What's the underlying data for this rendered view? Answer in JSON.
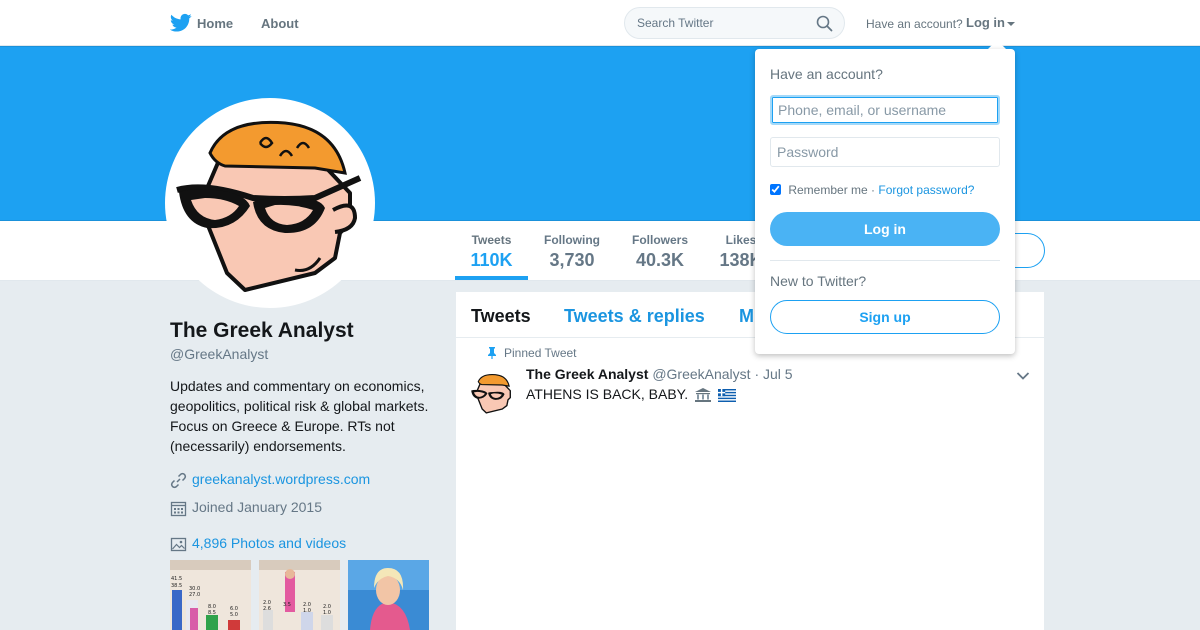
{
  "nav": {
    "home_label": "Home",
    "about_label": "About",
    "search_placeholder": "Search Twitter",
    "have_account_text": "Have an account?",
    "login_label": "Log in"
  },
  "profile": {
    "name": "The Greek Analyst",
    "handle": "@GreekAnalyst",
    "bio": "Updates and commentary on economics, geopolitics, political risk & global markets. Focus on Greece & Europe. RTs not (necessarily) endorsements.",
    "website": "greekanalyst.wordpress.com",
    "joined": "Joined January 2015",
    "photos_label": "4,896 Photos and videos"
  },
  "stats": [
    {
      "label": "Tweets",
      "value": "110K",
      "active": true
    },
    {
      "label": "Following",
      "value": "3,730",
      "active": false
    },
    {
      "label": "Followers",
      "value": "40.3K",
      "active": false
    },
    {
      "label": "Likes",
      "value": "138K",
      "active": false
    }
  ],
  "timeline": {
    "tabs": [
      {
        "label": "Tweets",
        "active": true
      },
      {
        "label": "Tweets & replies",
        "active": false
      },
      {
        "label": "M",
        "active": false
      }
    ],
    "pinned_label": "Pinned Tweet",
    "tweet": {
      "name": "The Greek Analyst",
      "handle": "@GreekAnalyst",
      "date": "· Jul 5",
      "text": "ATHENS IS BACK, BABY."
    }
  },
  "login_dropdown": {
    "title": "Have an account?",
    "username_placeholder": "Phone, email, or username",
    "password_placeholder": "Password",
    "remember_label": "Remember me ·",
    "forgot_label": "Forgot password?",
    "login_button": "Log in",
    "new_text": "New to Twitter?",
    "signup_button": "Sign up"
  },
  "colors": {
    "brand": "#1da1f2",
    "background": "#e6ecf0"
  },
  "icons": [
    "twitter-bird-icon",
    "search-icon",
    "link-icon",
    "calendar-icon",
    "photo-icon",
    "pin-icon",
    "chevron-down-icon",
    "classical-building-icon",
    "greek-flag-icon"
  ]
}
